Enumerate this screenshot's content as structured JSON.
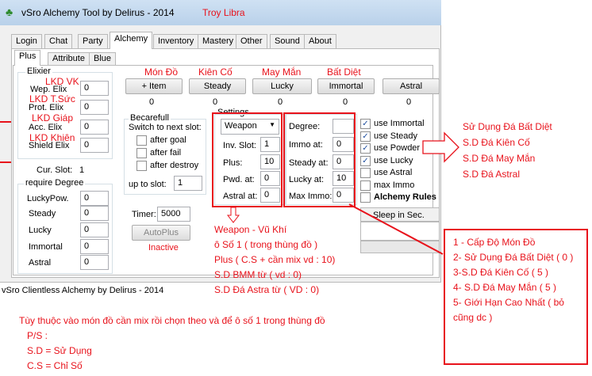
{
  "window": {
    "title": "vSro Alchemy Tool by Delirus - 2014",
    "subtitle": "Troy Libra",
    "icon": "clover-icon"
  },
  "tabs": [
    "Login",
    "Chat",
    "Party",
    "Alchemy",
    "Inventory",
    "Mastery",
    "Other",
    "Sound",
    "About"
  ],
  "subtabs": [
    "Plus",
    "Attribute",
    "Blue"
  ],
  "elixier": {
    "title": "Elixier",
    "items": [
      {
        "label": "Wep. Elix",
        "value": "0"
      },
      {
        "label": "Prot. Elix",
        "value": "0"
      },
      {
        "label": "Acc. Elix",
        "value": "0"
      },
      {
        "label": "Shield Elix",
        "value": "0"
      }
    ]
  },
  "cur_slot": {
    "label": "Cur. Slot:",
    "value": "1"
  },
  "degree_group": {
    "title": "require Degree",
    "items": [
      {
        "label": "LuckyPow.",
        "value": "0"
      },
      {
        "label": "Steady",
        "value": "0"
      },
      {
        "label": "Lucky",
        "value": "0"
      },
      {
        "label": "Immortal",
        "value": "0"
      },
      {
        "label": "Astral",
        "value": "0"
      }
    ]
  },
  "buttons": [
    {
      "label": "+ Item",
      "count": "0"
    },
    {
      "label": "Steady",
      "count": "0"
    },
    {
      "label": "Lucky",
      "count": "0"
    },
    {
      "label": "Immortal",
      "count": "0"
    },
    {
      "label": "Astral",
      "count": "0"
    }
  ],
  "becarefull": {
    "title": "Becarefull",
    "subtitle": "Switch to next slot:",
    "options": [
      "after goal",
      "after fail",
      "after destroy"
    ],
    "up_to_label": "up to slot:",
    "up_to_value": "1"
  },
  "timer": {
    "label": "Timer:",
    "value": "5000"
  },
  "autoplus": {
    "label": "AutoPlus",
    "status": "Inactive"
  },
  "settings": {
    "title": "Settings",
    "dropdown": "Weapon",
    "fields": [
      {
        "label": "Inv. Slot:",
        "value": "1"
      },
      {
        "label": "Plus:",
        "value": "10"
      },
      {
        "label": "Pwd. at:",
        "value": "0"
      },
      {
        "label": "Astral at:",
        "value": "0"
      }
    ]
  },
  "degree_settings": {
    "fields": [
      {
        "label": "Degree:",
        "value": ""
      },
      {
        "label": "Immo at:",
        "value": "0"
      },
      {
        "label": "Steady at:",
        "value": "0"
      },
      {
        "label": "Lucky at:",
        "value": "10"
      },
      {
        "label": "Max Immo:",
        "value": "0"
      }
    ]
  },
  "checkboxes": [
    {
      "label": "use Immortal",
      "checked": true
    },
    {
      "label": "use Steady",
      "checked": true
    },
    {
      "label": "use Powder",
      "checked": true
    },
    {
      "label": "use Lucky",
      "checked": true
    },
    {
      "label": "use Astral",
      "checked": false
    },
    {
      "label": "max Immo",
      "checked": false
    }
  ],
  "rules_label": "Alchemy Rules",
  "sleep_label": "Sleep in Sec.",
  "log_text": "vSro Clientless Alchemy by Delirus - 2014",
  "annotations": {
    "mon_do": "Món Đồ",
    "kien_co": "Kiên Cố",
    "may_man": "May Mắn",
    "bat_diet": "Bất Diệt",
    "lkd_vk": "LKD VK",
    "lkd_tsuc": "LKD T.Sức",
    "lkd_giap": "LKD Giáp",
    "lkd_khien": "LKD Khiên",
    "weapon_notes": [
      "Weapon - Vũ Khí",
      "ô Số 1 ( trong thùng đồ )",
      "Plus ( C.S + cần mix vd : 10)",
      "S.D BMM từ ( vd : 0)",
      "S.D Đá Astra từ ( VD : 0)"
    ],
    "right_top": [
      "Sử Dụng Đá Bất Diệt",
      "S.D Đá Kiên Cố",
      "S.D Đá May Mắn",
      "S.D Đá Astral"
    ],
    "right_box": [
      "1 - Cấp Độ Món Đồ",
      "2- Sử Dụng Đá Bất Diệt ( 0 )",
      "3-S.D Đá Kiên Cố ( 5 )",
      "4- S.D Đá May Mắn ( 5 )",
      "5- Giới Hạn Cao Nhất ( bỏ",
      "cũng dc )"
    ],
    "bottom": [
      "Tùy thuộc vào món đồ cần mix rồi chọn theo và để ô số 1 trong thùng đồ",
      "P/S :",
      "S.D = Sử Dụng",
      "C.S = Chỉ Số"
    ]
  },
  "colors": {
    "annotation": "#e8121b",
    "checkbox_tick": "#1e4e9f"
  }
}
